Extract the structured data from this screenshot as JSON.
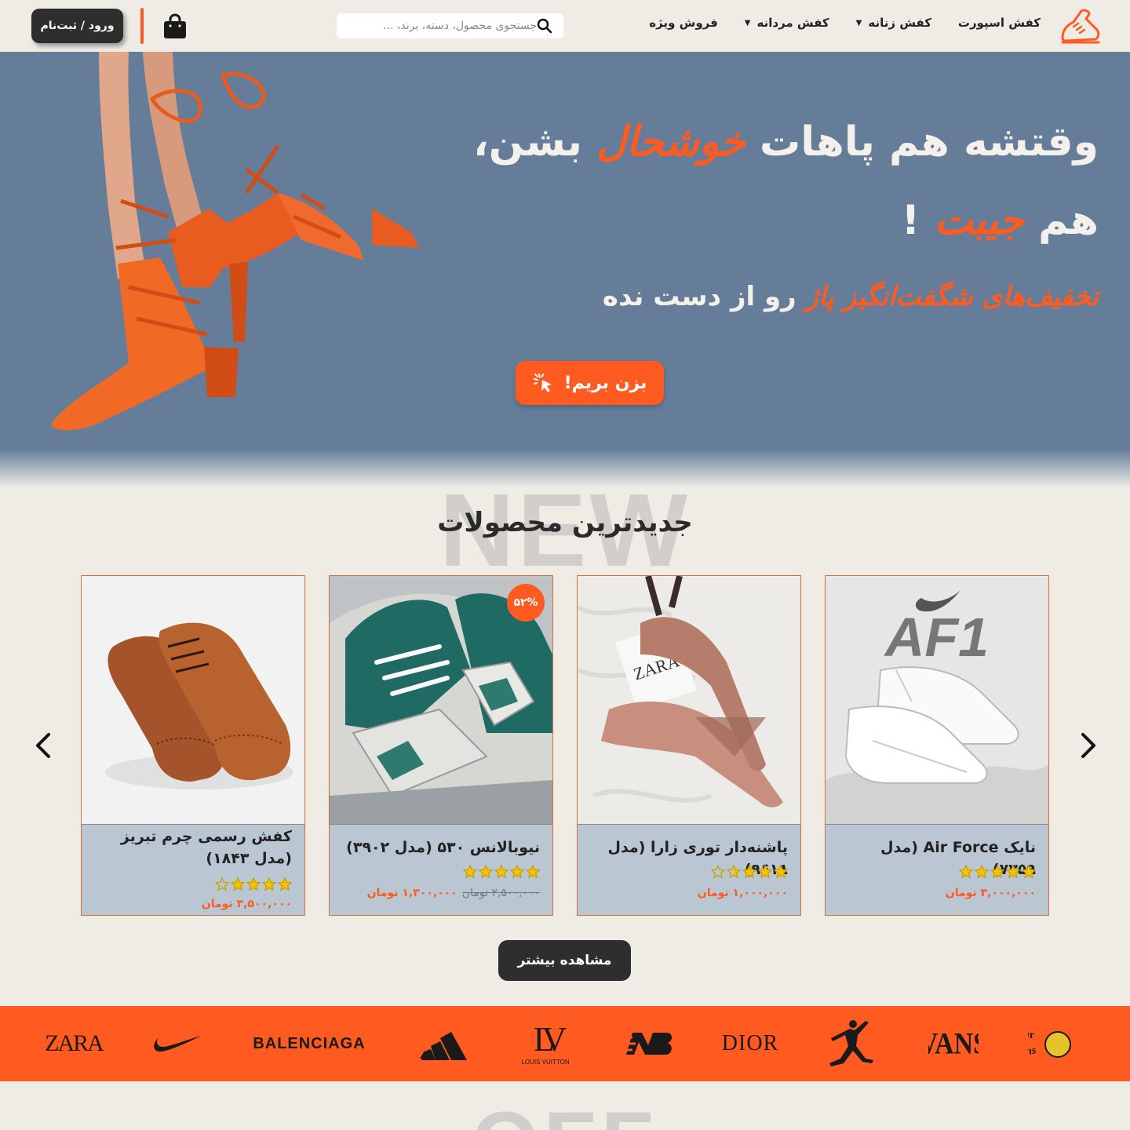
{
  "header": {
    "logo_name": "shoe-logo-icon",
    "nav": [
      {
        "label": "کفش اسپورت",
        "has_dropdown": false
      },
      {
        "label": "کفش زنانه",
        "has_dropdown": true
      },
      {
        "label": "کفش مردانه",
        "has_dropdown": true
      },
      {
        "label": "فروش ویژه",
        "has_dropdown": false
      }
    ],
    "search_placeholder": "جستجوی محصول، دسته، برند، ...",
    "login_label": "ورود / ثبت‌نام"
  },
  "hero": {
    "line1_a": "وقتشه هم پاهات ",
    "line1_accent": "خوشحال",
    "line1_b": " بشن،",
    "line2_a": "هم ",
    "line2_accent": "جیبت",
    "line2_b": " !",
    "line3_accent": "تخفیف‌های شگفت‌انگیز پاژ",
    "line3_b": " رو از دست نده",
    "cta_label": "بزن بریم!"
  },
  "new_products": {
    "bg_word": "NEW",
    "title": "جدیدترین محصولات",
    "products": [
      {
        "name": "نایک Air Force (مدل ۷۳۵۹)",
        "rating": 5,
        "price": "۳,۰۰۰,۰۰۰ تومان",
        "old_price": "",
        "discount": ""
      },
      {
        "name": "پاشنه‌دار توری زارا (مدل ۹۶۱۸)",
        "rating": 3.5,
        "price": "۱,۰۰۰,۰۰۰ تومان",
        "old_price": "",
        "discount": ""
      },
      {
        "name": "نیوبالانس ۵۳۰ (مدل ۳۹۰۲)",
        "rating": 5,
        "price": "۱,۳۰۰,۰۰۰ تومان",
        "old_price": "۲,۵۰۰,۰۰۰ تومان",
        "discount": "۵۲%"
      },
      {
        "name": "کفش رسمی چرم تبریز (مدل ۱۸۴۳)",
        "rating": 4,
        "price": "۳,۵۰۰,۰۰۰ تومان",
        "old_price": "",
        "discount": ""
      }
    ],
    "af1_print": "AF1",
    "zara_print": "ZARA",
    "more_label": "مشاهده بیشتر"
  },
  "brands": [
    "Dr. Martens",
    "VANS",
    "Jordan",
    "DIOR",
    "New Balance",
    "LOUIS VUITTON",
    "adidas",
    "BALENCIAGA",
    "Nike",
    "ZARA"
  ],
  "brand_texts": {
    "dior": "DIOR",
    "balenciaga": "BALENCIAGA",
    "zara": "ZARA",
    "vans": "VANS",
    "lv_mono": "LV",
    "lv": "LOUIS VUITTON",
    "drm_1": "Dr.",
    "drm_2": "Martens"
  },
  "off_word": "OFF",
  "colors": {
    "accent": "#ff5a1f",
    "hero_bg": "#657d98",
    "page_bg": "#efece6",
    "dark_button": "#2e2e2e",
    "card_bg": "#bac7d2"
  }
}
